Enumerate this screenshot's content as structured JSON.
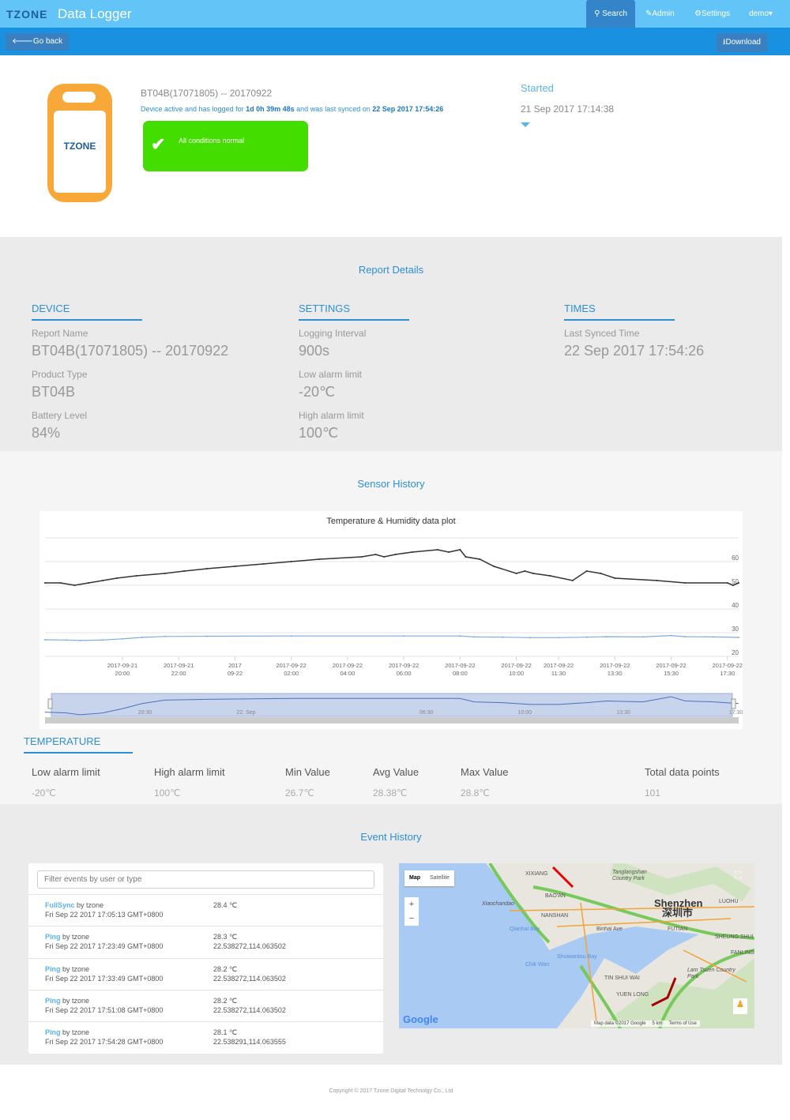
{
  "header": {
    "logo": "TZONE",
    "title": "Data Logger",
    "nav": [
      "Search",
      "Admin",
      "Settings",
      "demo"
    ]
  },
  "toolbar": {
    "back": "Go back",
    "download": "Download"
  },
  "device": {
    "logo": "TZONE",
    "report_name": "BT04B(17071805) -- 20170922",
    "status_prefix": "Device active and has logged for",
    "duration": "1d 0h 39m 48s",
    "status_mid": "and was last synced on",
    "last_sync": "22 Sep 2017 17:54:26",
    "alert": "All conditions normal",
    "started_label": "Started",
    "started_value": "21 Sep 2017 17:14:38"
  },
  "report": {
    "title": "Report Details",
    "columns": [
      {
        "heading": "DEVICE",
        "fields": [
          {
            "label": "Report Name",
            "value": "BT04B(17071805) -- 20170922"
          },
          {
            "label": "Product Type",
            "value": "BT04B"
          },
          {
            "label": "Battery Level",
            "value": "84%"
          }
        ]
      },
      {
        "heading": "SETTINGS",
        "fields": [
          {
            "label": "Logging Interval",
            "value": "900s"
          },
          {
            "label": "Low alarm limit",
            "value": "-20℃"
          },
          {
            "label": "High alarm limit",
            "value": "100℃"
          }
        ]
      },
      {
        "heading": "TIMES",
        "fields": [
          {
            "label": "Last Synced Time",
            "value": "22 Sep 2017 17:54:26"
          }
        ]
      }
    ]
  },
  "sensor": {
    "title": "Sensor History",
    "temp_heading": "TEMPERATURE",
    "stats": [
      {
        "label": "Low alarm limit",
        "value": "-20℃"
      },
      {
        "label": "High alarm limit",
        "value": "100℃"
      },
      {
        "label": "Min Value",
        "value": "26.7℃"
      },
      {
        "label": "Avg Value",
        "value": "28.38℃"
      },
      {
        "label": "Max Value",
        "value": "28.8℃"
      },
      {
        "label": "Total data points",
        "value": "101"
      }
    ]
  },
  "chart_data": {
    "type": "line",
    "title": "Temperature & Humidity data plot",
    "xunit": "hours since 2017-09-21 00:00",
    "xlim": [
      17.25,
      41.9
    ],
    "ylim": [
      20,
      70
    ],
    "yticks": [
      20,
      30,
      40,
      50,
      60
    ],
    "xticks": [
      {
        "x": 20,
        "l1": "2017-09-21",
        "l2": "20:00"
      },
      {
        "x": 22,
        "l1": "2017-09-21",
        "l2": "22:00"
      },
      {
        "x": 24,
        "l1": "2017",
        "l2": "09-22"
      },
      {
        "x": 26,
        "l1": "2017-09-22",
        "l2": "02:00"
      },
      {
        "x": 28,
        "l1": "2017-09-22",
        "l2": "04:00"
      },
      {
        "x": 30,
        "l1": "2017-09-22",
        "l2": "06:00"
      },
      {
        "x": 32,
        "l1": "2017-09-22",
        "l2": "08:00"
      },
      {
        "x": 34,
        "l1": "2017-09-22",
        "l2": "10:00"
      },
      {
        "x": 35.5,
        "l1": "2017-09-22",
        "l2": "11:30"
      },
      {
        "x": 37.5,
        "l1": "2017-09-22",
        "l2": "13:30"
      },
      {
        "x": 39.5,
        "l1": "2017-09-22",
        "l2": "15:30"
      },
      {
        "x": 41.5,
        "l1": "2017-09-22",
        "l2": "17:30"
      }
    ],
    "navigator_labels": [
      {
        "x": 20.5,
        "l": "20:30"
      },
      {
        "x": 24,
        "l": "22. Sep"
      },
      {
        "x": 30.5,
        "l": "06:30"
      },
      {
        "x": 34,
        "l": "10:00"
      },
      {
        "x": 37.5,
        "l": "13:30"
      },
      {
        "x": 41.5,
        "l": "17:30"
      }
    ],
    "series": [
      {
        "name": "Humidity",
        "color": "#333333",
        "x": [
          17.25,
          17.8,
          18.3,
          18.8,
          19.3,
          19.8,
          20.5,
          21.5,
          22.2,
          23,
          24,
          25,
          26,
          27,
          28.5,
          29,
          29.3,
          29.7,
          30.3,
          31.2,
          31.6,
          32,
          32.2,
          32.7,
          33.2,
          34,
          34.3,
          34.6,
          35.2,
          36,
          36.5,
          37,
          37.5,
          39,
          40,
          41.5,
          41.7,
          41.9
        ],
        "y": [
          51,
          51,
          50,
          51,
          52,
          53,
          54,
          55,
          56,
          57,
          58,
          59,
          60,
          61,
          62,
          63,
          62,
          63,
          64,
          65,
          64,
          65,
          62,
          61,
          58,
          55,
          56,
          55,
          54,
          52,
          56,
          55,
          53,
          52,
          51,
          51,
          50,
          51
        ]
      },
      {
        "name": "Temperature",
        "color": "#7aaee0",
        "x": [
          17.25,
          18,
          18.5,
          19.3,
          20,
          20.7,
          21.5,
          23,
          26,
          30,
          32,
          32.5,
          33.5,
          34.5,
          35.5,
          36.5,
          37.2,
          38.5,
          39.5,
          40,
          41,
          41.9
        ],
        "y": [
          27.0,
          26.9,
          26.7,
          26.9,
          27.4,
          28.0,
          28.4,
          28.5,
          28.6,
          28.6,
          28.6,
          28.2,
          28.1,
          27.9,
          27.9,
          28.1,
          28.3,
          28.2,
          28.8,
          28.3,
          28.2,
          28.0
        ]
      }
    ]
  },
  "events": {
    "title": "Event History",
    "filter_placeholder": "Filter events by user or type",
    "items": [
      {
        "type": "FullSync",
        "by": "by tzone",
        "time": "Fri Sep 22 2017 17:05:13 GMT+0800",
        "temp": "28.4 ℃",
        "loc": ""
      },
      {
        "type": "Ping",
        "by": "by tzone",
        "time": "Fri Sep 22 2017 17:23:49 GMT+0800",
        "temp": "28.3 ℃",
        "loc": "22.538272,114.063502"
      },
      {
        "type": "Ping",
        "by": "by tzone",
        "time": "Fri Sep 22 2017 17:33:49 GMT+0800",
        "temp": "28.2 ℃",
        "loc": "22.538272,114.063502"
      },
      {
        "type": "Ping",
        "by": "by tzone",
        "time": "Fri Sep 22 2017 17:51:08 GMT+0800",
        "temp": "28.2 ℃",
        "loc": "22.538272,114.063502"
      },
      {
        "type": "Ping",
        "by": "by tzone",
        "time": "Fri Sep 22 2017 17:54:28 GMT+0800",
        "temp": "28.1 ℃",
        "loc": "22.538291,114.063555"
      }
    ]
  },
  "map": {
    "map_btn": "Map",
    "sat_btn": "Satellite",
    "zoom_in": "+",
    "zoom_out": "−",
    "city": "Shenzhen",
    "city_cn": "深圳市",
    "places": [
      "Tanglangshan Country Park",
      "BAO'AN",
      "Xiaochandao",
      "NANSHAN",
      "Qianhai Bay",
      "Shuiwantou Bay",
      "Chik Wan",
      "Lam Tsuen Country Park",
      "TIN SHUI WAI",
      "YUEN LONG",
      "FUTIAN",
      "SHEUNG SHUI",
      "FANLING",
      "LUOHU",
      "XIXIANG",
      "Binhai Ave"
    ],
    "google": "Google",
    "attribution": "Map data ©2017 Google",
    "scale": "5 km",
    "terms": "Terms of Use"
  },
  "footer": "Copyright © 2017 Tzone Digital Technolgy Co., Ltd"
}
